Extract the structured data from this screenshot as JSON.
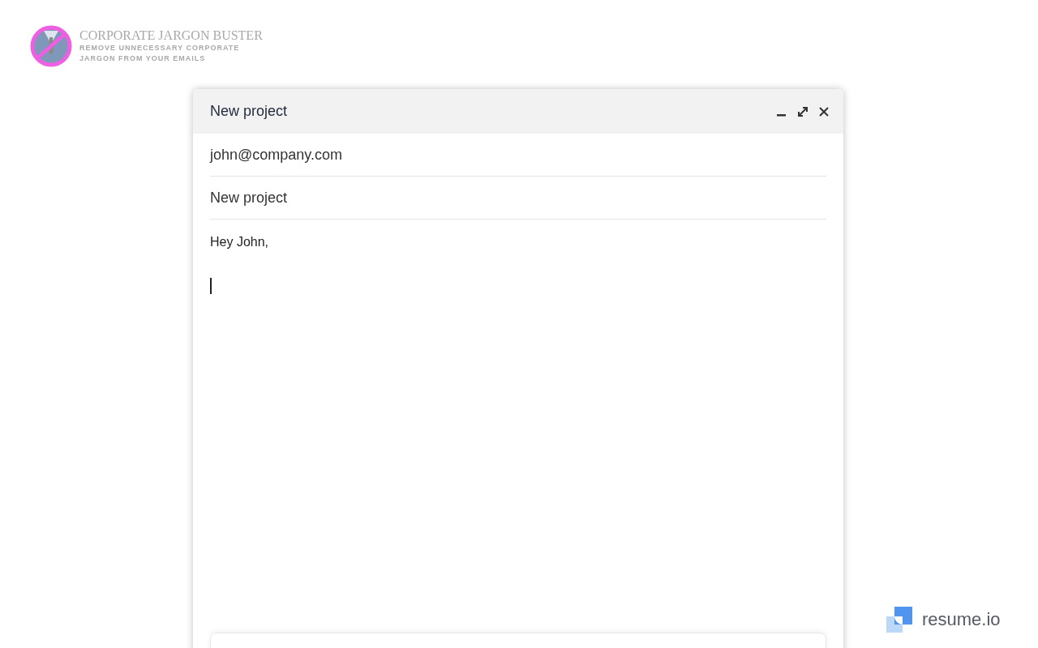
{
  "brand": {
    "title": "CORPORATE JARGON BUSTER",
    "subtitle": "REMOVE UNNECESSARY CORPORATE JARGON FROM YOUR EMAILS"
  },
  "compose": {
    "title": "New project",
    "to": "john@company.com",
    "subject": "New project",
    "body": "Hey John,"
  },
  "footer_logo": {
    "text": "resume.io"
  }
}
